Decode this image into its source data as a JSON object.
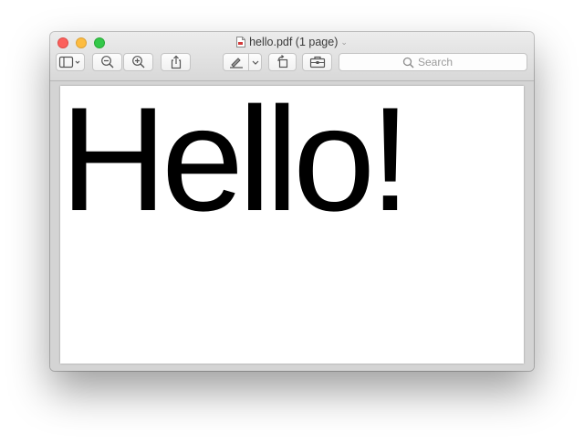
{
  "window": {
    "title": "hello.pdf (1 page)"
  },
  "toolbar": {
    "buttons": [
      {
        "icon": "sidebar-icon",
        "has_dropdown": true
      },
      {
        "icon": "zoom-out-icon"
      },
      {
        "icon": "zoom-in-icon"
      },
      {
        "icon": "share-icon"
      },
      {
        "icon": "markup-pen-icon",
        "has_dropdown": true
      },
      {
        "icon": "rotate-icon"
      },
      {
        "icon": "toolbox-icon"
      }
    ],
    "search_placeholder": "Search"
  },
  "document": {
    "page_text": "Hello!"
  },
  "colors": {
    "close": "#fc605c",
    "minimize": "#fdbc40",
    "zoom": "#34c84a"
  }
}
